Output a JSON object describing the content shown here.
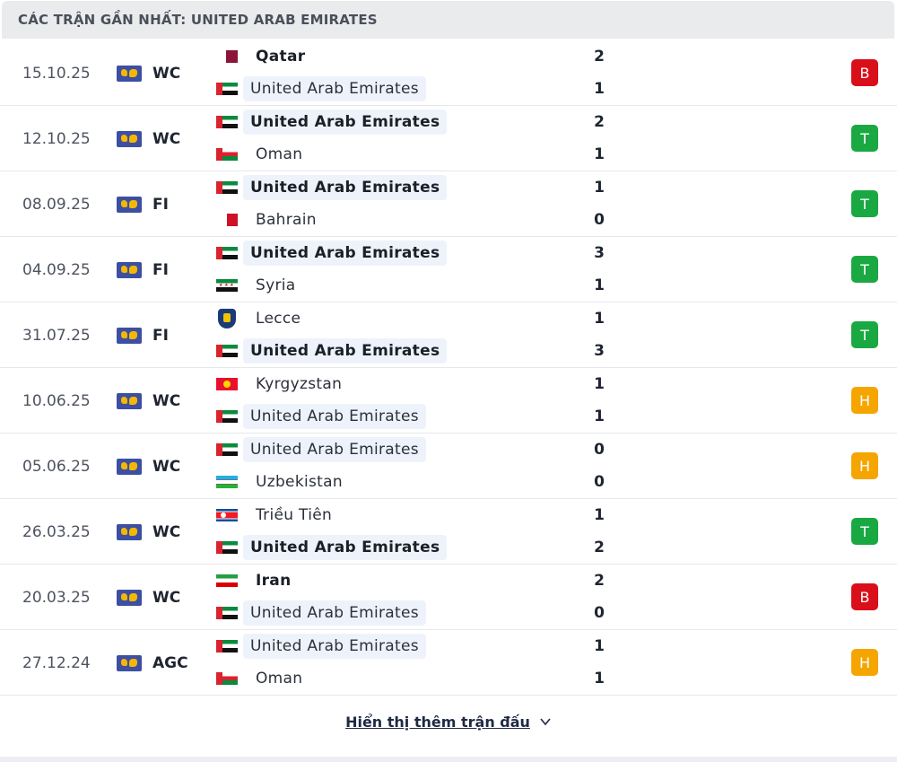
{
  "header": {
    "title": "CÁC TRẬN GẦN NHẤT: UNITED ARAB EMIRATES"
  },
  "colors": {
    "loss": "#d90f1a",
    "win": "#1aa842",
    "draw": "#f5a500"
  },
  "matches": [
    {
      "date": "15.10.25",
      "competition": "WC",
      "home": {
        "name": "Qatar",
        "flag": "qatar"
      },
      "away": {
        "name": "United Arab Emirates",
        "flag": "uae"
      },
      "home_score": "2",
      "away_score": "1",
      "result": "B",
      "result_kind": "loss",
      "winner": "home",
      "uae_side": "away"
    },
    {
      "date": "12.10.25",
      "competition": "WC",
      "home": {
        "name": "United Arab Emirates",
        "flag": "uae"
      },
      "away": {
        "name": "Oman",
        "flag": "oman"
      },
      "home_score": "2",
      "away_score": "1",
      "result": "T",
      "result_kind": "win",
      "winner": "home",
      "uae_side": "home"
    },
    {
      "date": "08.09.25",
      "competition": "FI",
      "home": {
        "name": "United Arab Emirates",
        "flag": "uae"
      },
      "away": {
        "name": "Bahrain",
        "flag": "bahrain"
      },
      "home_score": "1",
      "away_score": "0",
      "result": "T",
      "result_kind": "win",
      "winner": "home",
      "uae_side": "home"
    },
    {
      "date": "04.09.25",
      "competition": "FI",
      "home": {
        "name": "United Arab Emirates",
        "flag": "uae"
      },
      "away": {
        "name": "Syria",
        "flag": "syria"
      },
      "home_score": "3",
      "away_score": "1",
      "result": "T",
      "result_kind": "win",
      "winner": "home",
      "uae_side": "home"
    },
    {
      "date": "31.07.25",
      "competition": "FI",
      "home": {
        "name": "Lecce",
        "flag": "lecce"
      },
      "away": {
        "name": "United Arab Emirates",
        "flag": "uae"
      },
      "home_score": "1",
      "away_score": "3",
      "result": "T",
      "result_kind": "win",
      "winner": "away",
      "uae_side": "away"
    },
    {
      "date": "10.06.25",
      "competition": "WC",
      "home": {
        "name": "Kyrgyzstan",
        "flag": "kyrgyzstan"
      },
      "away": {
        "name": "United Arab Emirates",
        "flag": "uae"
      },
      "home_score": "1",
      "away_score": "1",
      "result": "H",
      "result_kind": "draw",
      "winner": "none",
      "uae_side": "away"
    },
    {
      "date": "05.06.25",
      "competition": "WC",
      "home": {
        "name": "United Arab Emirates",
        "flag": "uae"
      },
      "away": {
        "name": "Uzbekistan",
        "flag": "uzbekistan"
      },
      "home_score": "0",
      "away_score": "0",
      "result": "H",
      "result_kind": "draw",
      "winner": "none",
      "uae_side": "home"
    },
    {
      "date": "26.03.25",
      "competition": "WC",
      "home": {
        "name": "Triều Tiên",
        "flag": "nkorea"
      },
      "away": {
        "name": "United Arab Emirates",
        "flag": "uae"
      },
      "home_score": "1",
      "away_score": "2",
      "result": "T",
      "result_kind": "win",
      "winner": "away",
      "uae_side": "away"
    },
    {
      "date": "20.03.25",
      "competition": "WC",
      "home": {
        "name": "Iran",
        "flag": "iran"
      },
      "away": {
        "name": "United Arab Emirates",
        "flag": "uae"
      },
      "home_score": "2",
      "away_score": "0",
      "result": "B",
      "result_kind": "loss",
      "winner": "home",
      "uae_side": "away"
    },
    {
      "date": "27.12.24",
      "competition": "AGC",
      "home": {
        "name": "United Arab Emirates",
        "flag": "uae"
      },
      "away": {
        "name": "Oman",
        "flag": "oman"
      },
      "home_score": "1",
      "away_score": "1",
      "result": "H",
      "result_kind": "draw",
      "winner": "none",
      "uae_side": "home"
    }
  ],
  "footer": {
    "more_label": "Hiển thị thêm trận đấu",
    "more_icon": "chevron-down-icon"
  }
}
